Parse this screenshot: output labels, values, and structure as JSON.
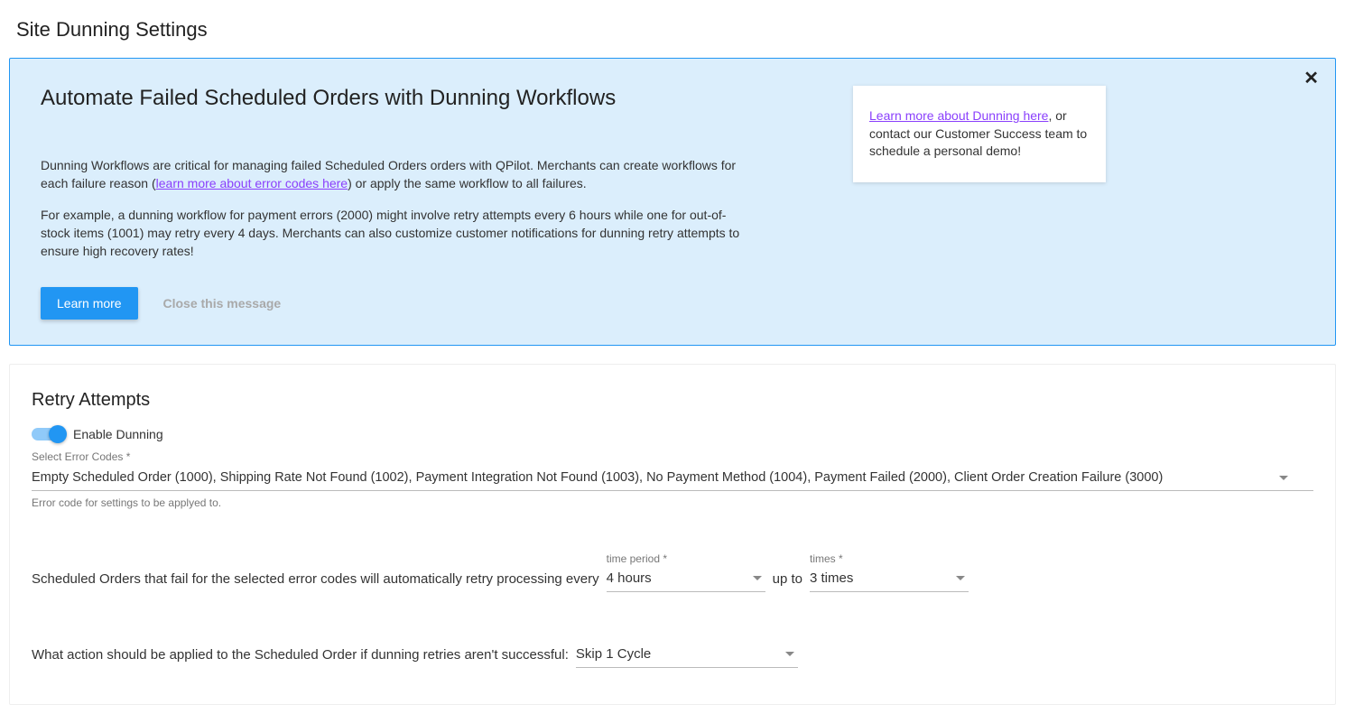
{
  "page_title": "Site Dunning Settings",
  "info": {
    "heading": "Automate Failed Scheduled Orders with Dunning Workflows",
    "para1_pre": "Dunning Workflows are critical for managing failed Scheduled Orders orders with QPilot. Merchants can create workflows for each failure reason (",
    "para1_link": "learn more about error codes here",
    "para1_post": ") or apply the same workflow to all failures.",
    "para2": "For example, a dunning workflow for payment errors (2000) might involve retry attempts every 6 hours while one for out-of-stock items (1001) may retry every 4 days. Merchants can also customize customer notifications for dunning retry attempts to ensure high recovery rates!",
    "learn_more_btn": "Learn more",
    "close_btn": "Close this message",
    "side_link": "Learn more about Dunning here",
    "side_text_post": ", or contact our Customer Success team to schedule a personal demo!"
  },
  "retry": {
    "section_title": "Retry Attempts",
    "toggle_label": "Enable Dunning",
    "error_codes_label": "Select Error Codes *",
    "error_codes_value": "Empty Scheduled Order (1000), Shipping Rate Not Found (1002), Payment Integration Not Found (1003), No Payment Method (1004), Payment Failed (2000), Client Order Creation Failure (3000)",
    "error_codes_helper": "Error code for settings to be applyed to.",
    "sentence_lead": "Scheduled Orders that fail for the selected error codes will automatically retry processing every",
    "time_period_label": "time period *",
    "time_period_value": "4 hours",
    "sentence_mid": "up to",
    "times_label": "times *",
    "times_value": "3 times",
    "action_lead": "What action should be applied to the Scheduled Order if dunning retries aren't successful:",
    "action_value": "Skip 1 Cycle"
  }
}
